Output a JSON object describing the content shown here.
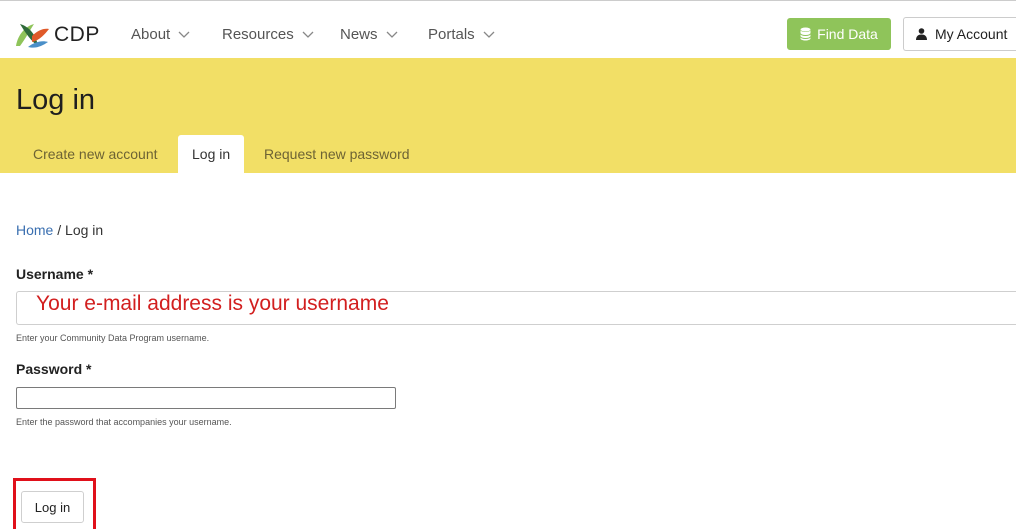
{
  "header": {
    "logo_text": "CDP",
    "nav": [
      "About",
      "Resources",
      "News",
      "Portals"
    ],
    "find_data": "Find Data",
    "my_account": "My Account"
  },
  "page": {
    "title": "Log in",
    "tabs": [
      {
        "label": "Create new account",
        "active": false
      },
      {
        "label": "Log in",
        "active": true
      },
      {
        "label": "Request new password",
        "active": false
      }
    ]
  },
  "breadcrumb": {
    "home": "Home",
    "separator": "/",
    "current": "Log in"
  },
  "form": {
    "username_label": "Username *",
    "username_value": "",
    "username_help": "Enter your Community Data Program username.",
    "password_label": "Password *",
    "password_value": "",
    "password_help": "Enter the password that accompanies your username.",
    "submit": "Log in"
  },
  "annotation": {
    "text": "Your e-mail address is your username",
    "color": "#d21f1f"
  },
  "colors": {
    "band": "#f2df66",
    "find_data": "#8fc45a",
    "link": "#3a6fb0",
    "highlight": "#e0101a"
  }
}
